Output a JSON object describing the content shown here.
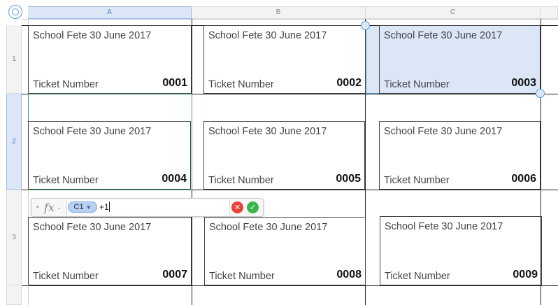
{
  "columns": [
    "A",
    "B",
    "C"
  ],
  "rows": [
    "1",
    "2",
    "3"
  ],
  "selected_column": "A",
  "selected_row": "2",
  "tickets": [
    {
      "event": "School Fete 30 June 2017",
      "label": "Ticket Number",
      "number": "0001"
    },
    {
      "event": "School Fete 30 June 2017",
      "label": "Ticket Number",
      "number": "0002"
    },
    {
      "event": "School Fete 30 June 2017",
      "label": "Ticket Number",
      "number": "0003"
    },
    {
      "event": "School Fete 30 June 2017",
      "label": "Ticket Number",
      "number": "0004"
    },
    {
      "event": "School Fete 30 June 2017",
      "label": "Ticket Number",
      "number": "0005"
    },
    {
      "event": "School Fete 30 June 2017",
      "label": "Ticket Number",
      "number": "0006"
    },
    {
      "event": "School Fete 30 June 2017",
      "label": "Ticket Number",
      "number": "0007"
    },
    {
      "event": "School Fete 30 June 2017",
      "label": "Ticket Number",
      "number": "0008"
    },
    {
      "event": "School Fete 30 June 2017",
      "label": "Ticket Number",
      "number": "0009"
    }
  ],
  "formula_bar": {
    "fx_label": "fx",
    "reference_token": "C1",
    "formula_rest": "+1"
  },
  "icons": {
    "corner": "table-select-icon",
    "cancel": "cancel-icon",
    "accept": "accept-icon"
  },
  "colors": {
    "selection": "#dbe6f7",
    "selection_border": "#5b9be0",
    "active_cell_border": "#3d9d6a",
    "cancel": "#e8413b",
    "accept": "#3bb64a"
  }
}
